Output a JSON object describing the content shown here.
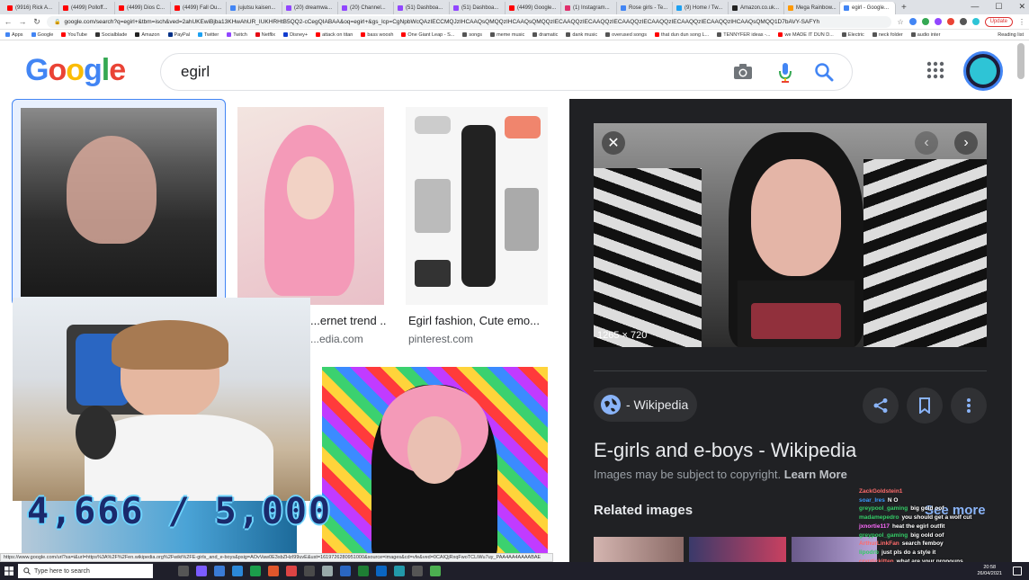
{
  "browser": {
    "tabs": [
      {
        "label": "(9916) Rick A...",
        "color": "#ff0000"
      },
      {
        "label": "(4499) Polloff...",
        "color": "#ff0000"
      },
      {
        "label": "(4499) Dios C...",
        "color": "#ff0000"
      },
      {
        "label": "(4499) Fall Ou...",
        "color": "#ff0000"
      },
      {
        "label": "jujutsu kaisen...",
        "color": "#4285f4"
      },
      {
        "label": "(20) dreamwa...",
        "color": "#9146ff"
      },
      {
        "label": "(20) Channel...",
        "color": "#9146ff"
      },
      {
        "label": "(51) Dashboa...",
        "color": "#9146ff"
      },
      {
        "label": "(51) Dashboa...",
        "color": "#9146ff"
      },
      {
        "label": "(4499) Google...",
        "color": "#ff0000"
      },
      {
        "label": "(1) Instagram...",
        "color": "#e1306c"
      },
      {
        "label": "Rose girls - Te...",
        "color": "#4285f4"
      },
      {
        "label": "(9) Home / Tw...",
        "color": "#1da1f2"
      },
      {
        "label": "Amazon.co.uk...",
        "color": "#222222"
      },
      {
        "label": "Mega Rainbow...",
        "color": "#ff9900"
      },
      {
        "label": "egirl - Google...",
        "color": "#4285f4",
        "active": true
      }
    ],
    "url": "google.com/search?q=egirl+&tbm=isch&ved=2ahUKEwiBjba13KHwAhUR_IUKHRHtB5QQ2-cCegQIABAA&oq=egirl+&gs_lcp=CgNpbWcQAzIECCMQJzIHCAAQsQMQQzIHCAAQsQMQQzIECAAQQzIECAAQQzIECAAQQzIECAAQQzIECAAQQzIECAAQQzIHCAAQsQMQQ1D7bAVY-SAFYh",
    "update_label": "Update",
    "bookmarks": [
      {
        "label": "Apps",
        "color": "#4285f4"
      },
      {
        "label": "Google",
        "color": "#4285f4"
      },
      {
        "label": "YouTube",
        "color": "#ff0000"
      },
      {
        "label": "Socialblade",
        "color": "#333333"
      },
      {
        "label": "Amazon",
        "color": "#222222"
      },
      {
        "label": "PayPal",
        "color": "#003087"
      },
      {
        "label": "Twitter",
        "color": "#1da1f2"
      },
      {
        "label": "Twitch",
        "color": "#9146ff"
      },
      {
        "label": "Netflix",
        "color": "#e50914"
      },
      {
        "label": "Disney+",
        "color": "#113ccf"
      },
      {
        "label": "attack on titan",
        "color": "#ff0000"
      },
      {
        "label": "bass woosh",
        "color": "#ff0000"
      },
      {
        "label": "One Giant Leap - S...",
        "color": "#ff0000"
      },
      {
        "label": "songs",
        "color": "#555555"
      },
      {
        "label": "meme music",
        "color": "#555555"
      },
      {
        "label": "dramatic",
        "color": "#555555"
      },
      {
        "label": "dank music",
        "color": "#555555"
      },
      {
        "label": "overused songs",
        "color": "#555555"
      },
      {
        "label": "that dun dun song L...",
        "color": "#ff0000"
      },
      {
        "label": "TENNYFER ideas -...",
        "color": "#555555"
      },
      {
        "label": "we MADE IT DUN D...",
        "color": "#ff0000"
      },
      {
        "label": "Electric",
        "color": "#555555"
      },
      {
        "label": "neck folder",
        "color": "#555555"
      },
      {
        "label": "audio inter",
        "color": "#555555"
      }
    ],
    "reading_list": "Reading list"
  },
  "google": {
    "logo": "Google",
    "query": "egirl"
  },
  "results": [
    {
      "title": "",
      "source": ""
    },
    {
      "title": "...ernet trend ...",
      "source": "...edia.com"
    },
    {
      "title": "Egirl fashion, Cute emo...",
      "source": "pinterest.com"
    }
  ],
  "panel": {
    "dimensions": "1265 × 720",
    "source": "- Wikipedia",
    "title": "E-girls and e-boys - Wikipedia",
    "copyright": "Images may be subject to copyright.",
    "learn_more": "Learn More",
    "related": "Related images",
    "see_more": "See more"
  },
  "stream": {
    "subgoal": "4,666 / 5,000",
    "chat": [
      {
        "user": "ZackGoldstein1",
        "msg": "",
        "color": "#ff6b6b"
      },
      {
        "user": "soar_Ires",
        "msg": "N O",
        "color": "#3a9bff"
      },
      {
        "user": "greypool_gaming",
        "msg": "big gold oof",
        "color": "#33cc66"
      },
      {
        "user": "madamepedro",
        "msg": "you should get a wolf cut",
        "color": "#33cc66"
      },
      {
        "user": "jxnortie117",
        "msg": "heat the egirl outfit",
        "color": "#ff6bff"
      },
      {
        "user": "greypool_gaming",
        "msg": "big oold oof",
        "color": "#33cc66"
      },
      {
        "user": "ArthurLinkFan",
        "msg": "search femboy",
        "color": "#ff6b6b"
      },
      {
        "user": "lipodrb",
        "msg": "just pls do a style it",
        "color": "#33cc66"
      },
      {
        "user": "cryptickitten",
        "msg": "what are your pronouns",
        "color": "#ff6b6b"
      }
    ]
  },
  "status_url": "https://www.google.com/url?sa=i&url=https%3A%2F%2Fen.wikipedia.org%2Fwiki%2FE-girls_and_e-boys&psig=AOvVaw0E3sbZHzI99uvE&ust=1619726280951000&source=images&cd=vfe&ved=0CAIQjRxqFwoTCLiWu7uy_PAA4AA4AAAABAE",
  "taskbar": {
    "search_placeholder": "Type here to search",
    "time": "20:58",
    "date": "26/04/2021"
  }
}
